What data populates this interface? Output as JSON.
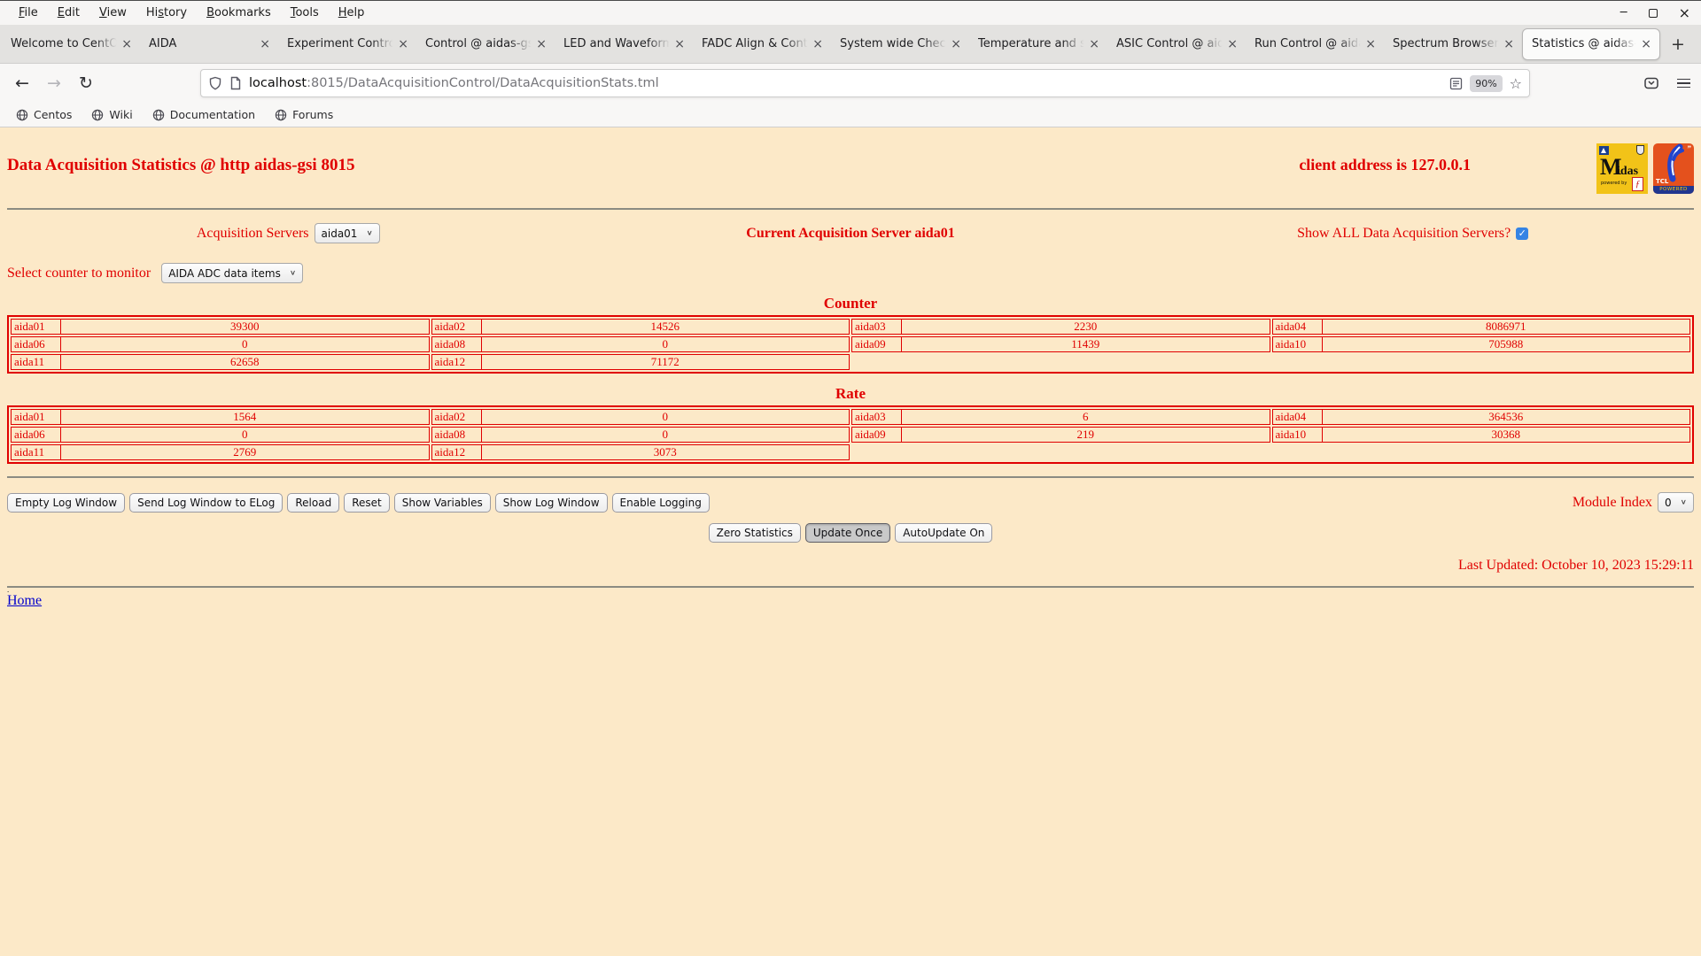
{
  "colors": {
    "page_bg": "#fce9c8",
    "accent_red": "#e00000",
    "link_blue": "#0000cc",
    "checkbox_blue": "#3584e4"
  },
  "browser": {
    "menu": [
      {
        "label": "File",
        "accel": 0
      },
      {
        "label": "Edit",
        "accel": 0
      },
      {
        "label": "View",
        "accel": 0
      },
      {
        "label": "History",
        "accel": 2
      },
      {
        "label": "Bookmarks",
        "accel": 0
      },
      {
        "label": "Tools",
        "accel": 0
      },
      {
        "label": "Help",
        "accel": 0
      }
    ],
    "tabs": [
      {
        "label": "Welcome to CentOS",
        "active": false
      },
      {
        "label": "AIDA",
        "active": false
      },
      {
        "label": "Experiment Control",
        "active": false
      },
      {
        "label": "Control @ aidas-gs",
        "active": false
      },
      {
        "label": "LED and Waveform",
        "active": false
      },
      {
        "label": "FADC Align & Cont",
        "active": false
      },
      {
        "label": "System wide Check",
        "active": false
      },
      {
        "label": "Temperature and s",
        "active": false
      },
      {
        "label": "ASIC Control @ aid",
        "active": false
      },
      {
        "label": "Run Control @ aida",
        "active": false
      },
      {
        "label": "Spectrum Browser",
        "active": false
      },
      {
        "label": "Statistics @ aidas-",
        "active": true
      }
    ],
    "new_tab_label": "+",
    "close_glyph": "×",
    "nav": {
      "back": "←",
      "forward": "→",
      "reload": "↻"
    },
    "url": {
      "host": "localhost",
      "path": ":8015/DataAcquisitionControl/DataAcquisitionStats.tml"
    },
    "zoom_level": "90%",
    "bookmarks": [
      "Centos",
      "Wiki",
      "Documentation",
      "Forums"
    ],
    "window_controls": {
      "minimize": "─",
      "close": "×"
    }
  },
  "page": {
    "title": "Data Acquisition Statistics @ http aidas-gsi 8015",
    "client_address": "client address is 127.0.0.1",
    "acquisition_servers_label": "Acquisition Servers",
    "acquisition_server_selected": "aida01",
    "current_server_text": "Current Acquisition Server aida01",
    "show_all_label": "Show ALL Data Acquisition Servers?",
    "show_all_checked": "✓",
    "counter_select_label": "Select counter to monitor",
    "counter_select_value": "AIDA ADC data items",
    "counter_heading": "Counter",
    "rate_heading": "Rate",
    "counter_rows": [
      [
        {
          "name": "aida01",
          "value": "39300"
        },
        {
          "name": "aida02",
          "value": "14526"
        },
        {
          "name": "aida03",
          "value": "2230"
        },
        {
          "name": "aida04",
          "value": "8086971"
        }
      ],
      [
        {
          "name": "aida06",
          "value": "0"
        },
        {
          "name": "aida08",
          "value": "0"
        },
        {
          "name": "aida09",
          "value": "11439"
        },
        {
          "name": "aida10",
          "value": "705988"
        }
      ],
      [
        {
          "name": "aida11",
          "value": "62658"
        },
        {
          "name": "aida12",
          "value": "71172"
        },
        null,
        null
      ]
    ],
    "rate_rows": [
      [
        {
          "name": "aida01",
          "value": "1564"
        },
        {
          "name": "aida02",
          "value": "0"
        },
        {
          "name": "aida03",
          "value": "6"
        },
        {
          "name": "aida04",
          "value": "364536"
        }
      ],
      [
        {
          "name": "aida06",
          "value": "0"
        },
        {
          "name": "aida08",
          "value": "0"
        },
        {
          "name": "aida09",
          "value": "219"
        },
        {
          "name": "aida10",
          "value": "30368"
        }
      ],
      [
        {
          "name": "aida11",
          "value": "2769"
        },
        {
          "name": "aida12",
          "value": "3073"
        },
        null,
        null
      ]
    ],
    "log_buttons": [
      "Empty Log Window",
      "Send Log Window to ELog",
      "Reload",
      "Reset",
      "Show Variables",
      "Show Log Window",
      "Enable Logging"
    ],
    "module_index_label": "Module Index",
    "module_index_value": "0",
    "action_buttons": [
      {
        "label": "Zero Statistics",
        "active": false
      },
      {
        "label": "Update Once",
        "active": true
      },
      {
        "label": "AutoUpdate On",
        "active": false
      }
    ],
    "last_updated": "Last Updated: October 10, 2023 15:29:11",
    "home_prefix": ".",
    "home_link": "Home"
  }
}
